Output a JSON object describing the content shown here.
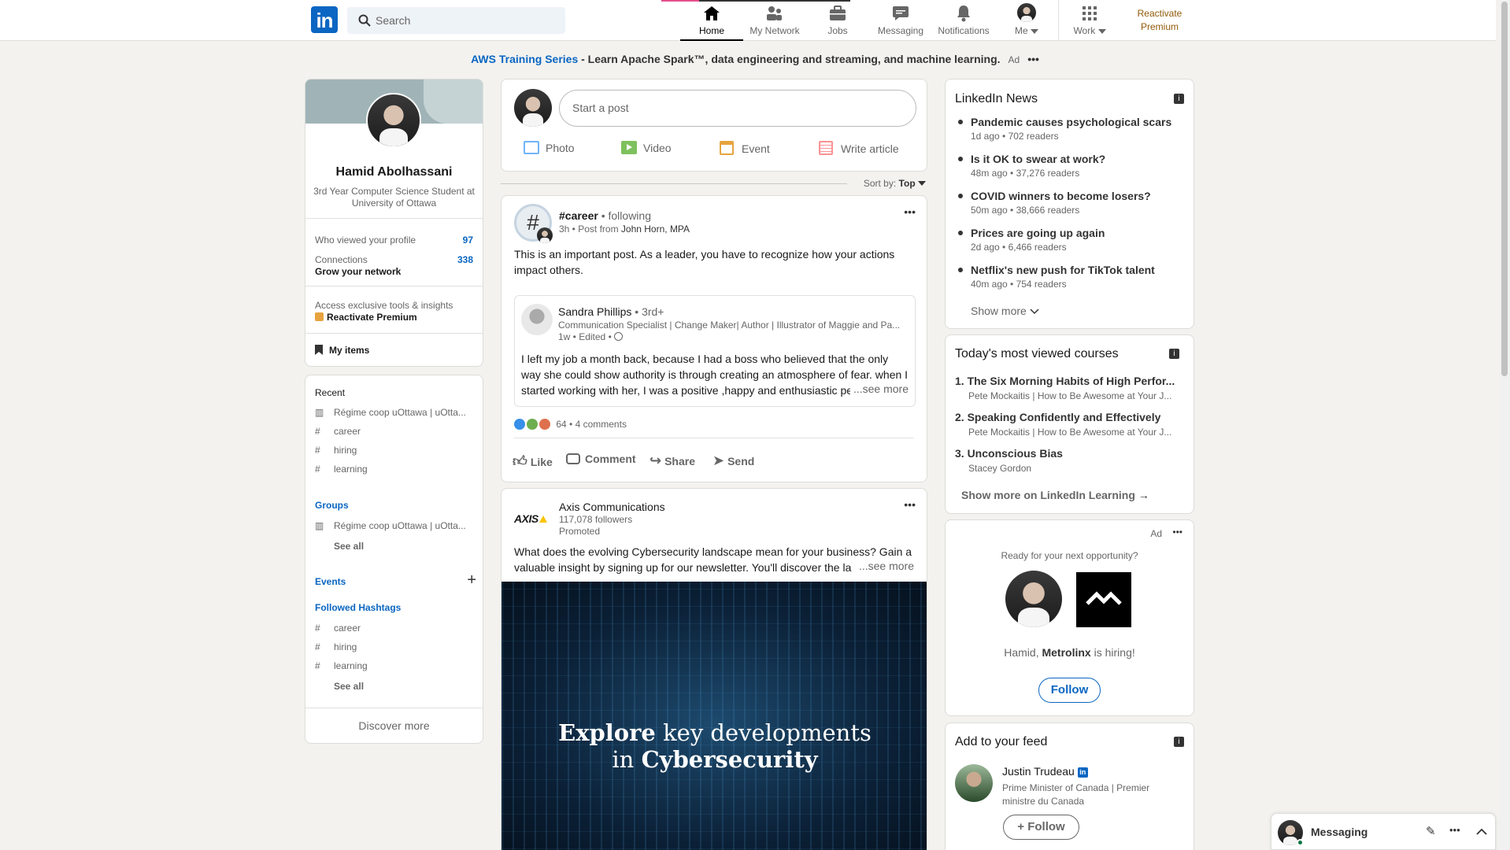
{
  "nav": {
    "search_placeholder": "Search",
    "items": [
      {
        "label": "Home",
        "icon": "home-icon"
      },
      {
        "label": "My Network",
        "icon": "network-icon"
      },
      {
        "label": "Jobs",
        "icon": "briefcase-icon"
      },
      {
        "label": "Messaging",
        "icon": "messaging-icon"
      },
      {
        "label": "Notifications",
        "icon": "bell-icon"
      },
      {
        "label": "Me",
        "icon": "avatar"
      },
      {
        "label": "Work",
        "icon": "grid-icon"
      }
    ],
    "premium": "Reactivate Premium"
  },
  "ad_banner": {
    "brand": "AWS Training Series",
    "text": " - Learn Apache Spark™, data engineering and streaming, and machine learning.",
    "tag": "Ad"
  },
  "profile": {
    "name": "Hamid Abolhassani",
    "headline": "3rd Year Computer Science Student at University of Ottawa",
    "viewed_label": "Who viewed your profile",
    "viewed_count": "97",
    "connections_label": "Connections",
    "connections_count": "338",
    "grow": "Grow your network",
    "access": "Access exclusive tools & insights",
    "premium": "Reactivate Premium",
    "my_items": "My items"
  },
  "left": {
    "recent_title": "Recent",
    "recent": [
      "Régime coop uOttawa | uOtta...",
      "career",
      "hiring",
      "learning"
    ],
    "groups_title": "Groups",
    "groups": [
      "Régime coop uOttawa | uOtta..."
    ],
    "see_all": "See all",
    "events_title": "Events",
    "hashtags_title": "Followed Hashtags",
    "hashtags": [
      "career",
      "hiring",
      "learning"
    ],
    "discover": "Discover more"
  },
  "composer": {
    "placeholder": "Start a post",
    "actions": [
      {
        "label": "Photo",
        "color": "#70b5f9"
      },
      {
        "label": "Video",
        "color": "#7fc15e"
      },
      {
        "label": "Event",
        "color": "#e7a33e"
      },
      {
        "label": "Write article",
        "color": "#fc9295"
      }
    ]
  },
  "sort": {
    "label": "Sort by:",
    "value": "Top"
  },
  "post1": {
    "hashtag": "#career",
    "following": "• following",
    "meta": "3h • Post from",
    "from": "John Horn, MPA",
    "text": "This is an important post. As a leader, you have to recognize how your actions impact others.",
    "inner": {
      "name": "Sandra Phillips",
      "degree": "• 3rd+",
      "headline": "Communication Specialist | Change Maker| Author | Illustrator of Maggie and Pa...",
      "meta": "1w • Edited •",
      "text": "I left my job a month back, because I had a boss who believed that the only way she could show authority is through creating an atmosphere of fear. when I started working with her, I was a positive ,happy and enthusiastic pe",
      "see_more": "...see more"
    },
    "reactions": "64",
    "comments": "• 4 comments",
    "actions": [
      "Like",
      "Comment",
      "Share",
      "Send"
    ]
  },
  "post2": {
    "company": "Axis Communications",
    "logo_text": "AXIS",
    "followers": "117,078 followers",
    "promoted": "Promoted",
    "text": "What does the evolving Cybersecurity landscape mean for your business? Gain a valuable insight by signing up for our newsletter. You'll discover the la",
    "see_more": "...see more",
    "image_line1_bold": "Explore",
    "image_line1_rest": " key developments",
    "image_line2_pre": "in ",
    "image_line2_bold": "Cybersecurity"
  },
  "news": {
    "title": "LinkedIn News",
    "items": [
      {
        "headline": "Pandemic causes psychological scars",
        "meta": "1d ago • 702 readers"
      },
      {
        "headline": "Is it OK to swear at work?",
        "meta": "48m ago • 37,276 readers"
      },
      {
        "headline": "COVID winners to become losers?",
        "meta": "50m ago • 38,666 readers"
      },
      {
        "headline": "Prices are going up again",
        "meta": "2d ago • 6,466 readers"
      },
      {
        "headline": "Netflix's new push for TikTok talent",
        "meta": "40m ago • 754 readers"
      }
    ],
    "show_more": "Show more"
  },
  "courses": {
    "title": "Today's most viewed courses",
    "items": [
      {
        "title": "1. The Six Morning Habits of High Perfor...",
        "meta": "Pete Mockaitis | How to Be Awesome at Your J..."
      },
      {
        "title": "2. Speaking Confidently and Effectively",
        "meta": "Pete Mockaitis | How to Be Awesome at Your J..."
      },
      {
        "title": "3. Unconscious Bias",
        "meta": "Stacey Gordon"
      }
    ],
    "show_more": "Show more on LinkedIn Learning"
  },
  "ad_card": {
    "tag": "Ad",
    "prompt": "Ready for your next opportunity?",
    "line_pre": "Hamid, ",
    "company": "Metrolinx",
    "line_post": " is hiring!",
    "follow": "Follow"
  },
  "feed": {
    "title": "Add to your feed",
    "person": "Justin Trudeau",
    "headline": "Prime Minister of Canada | Premier ministre du Canada",
    "follow": "Follow"
  },
  "messaging": {
    "label": "Messaging"
  }
}
